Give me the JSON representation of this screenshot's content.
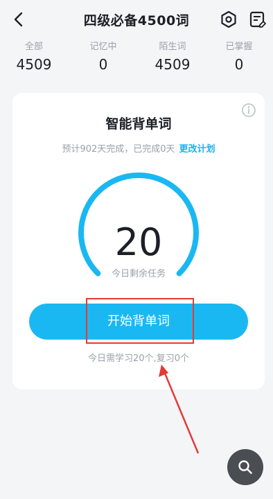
{
  "header": {
    "title": "四级必备4500词",
    "back_icon": "back-arrow-icon",
    "settings_icon": "settings-icon",
    "plan_icon": "word-plan-icon"
  },
  "stats": [
    {
      "label": "全部",
      "value": "4509"
    },
    {
      "label": "记忆中",
      "value": "0"
    },
    {
      "label": "陌生词",
      "value": "4509"
    },
    {
      "label": "已掌握",
      "value": "0"
    }
  ],
  "card": {
    "title": "智能背单词",
    "subtitle": "预计902天完成，已完成0天",
    "change_plan_link": "更改计划",
    "remaining_count": "20",
    "remaining_label": "今日剩余任务",
    "start_button": "开始背单词",
    "today_note": "今日需学习20个,复习0个",
    "accent_color": "#1ab8f2"
  },
  "fab": {
    "icon": "search-icon"
  },
  "annotation": {
    "color": "#e53935"
  }
}
